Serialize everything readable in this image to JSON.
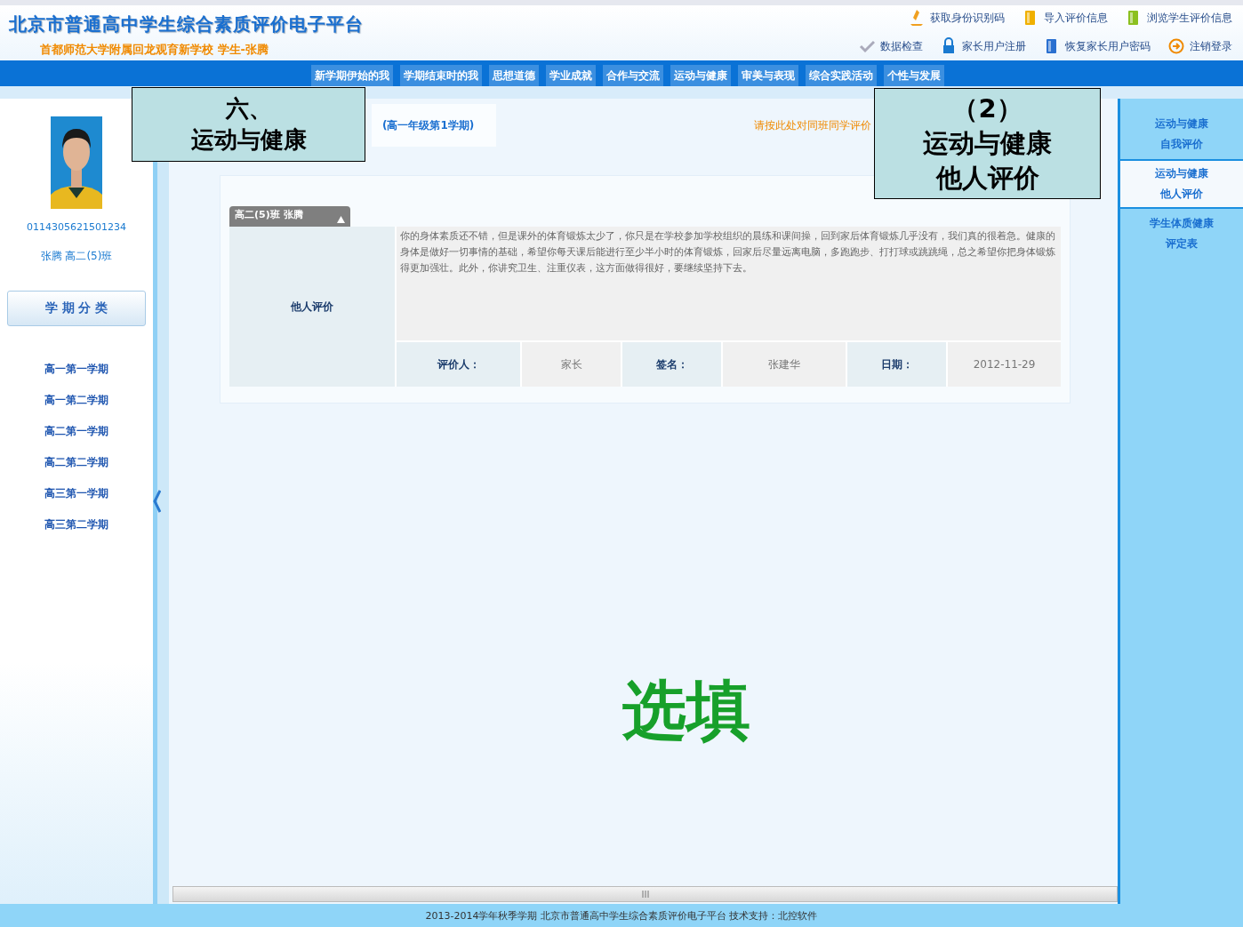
{
  "header": {
    "title": "北京市普通高中学生综合素质评价电子平台",
    "subtitle": "首都师范大学附属回龙观育新学校  学生-张腾",
    "links": [
      [
        {
          "label": "获取身份识别码"
        },
        {
          "label": "导入评价信息"
        },
        {
          "label": "浏览学生评价信息"
        }
      ],
      [
        {
          "label": "数据检查"
        },
        {
          "label": "家长用户注册"
        },
        {
          "label": "恢复家长用户密码"
        },
        {
          "label": "注销登录"
        }
      ]
    ]
  },
  "nav": [
    "新学期伊始的我",
    "学期结束时的我",
    "思想道德",
    "学业成就",
    "合作与交流",
    "运动与健康",
    "审美与表现",
    "综合实践活动",
    "个性与发展"
  ],
  "student": {
    "id": "0114305621501234",
    "name": "张腾 高二(5)班"
  },
  "semester_heading": "学 期 分 类",
  "semesters": [
    "高一第一学期",
    "高一第二学期",
    "高二第一学期",
    "高二第二学期",
    "高三第一学期",
    "高三第二学期"
  ],
  "main": {
    "tab": "(高一年级第1学期)",
    "peer_link": "请按此处对同班同学评价",
    "panel_title": "高二(5)班 张腾",
    "row_label": "他人评价",
    "comment": "你的身体素质还不错，但是课外的体育锻炼太少了，你只是在学校参加学校组织的晨练和课间操，回到家后体育锻炼几乎没有，我们真的很着急。健康的身体是做好一切事情的基础，希望你每天课后能进行至少半小时的体育锻炼，回家后尽量远离电脑，多跑跑步、打打球或跳跳绳，总之希望你把身体锻炼得更加强壮。此外，你讲究卫生、注重仪表，这方面做得很好，要继续坚持下去。",
    "fields": [
      {
        "label": "评价人：",
        "value": "家长"
      },
      {
        "label": "签名：",
        "value": "张建华"
      },
      {
        "label": "日期：",
        "value": "2012-11-29"
      }
    ]
  },
  "right_menu": [
    {
      "lines": [
        "运动与健康",
        "自我评价"
      ],
      "selected": false
    },
    {
      "lines": [
        "运动与健康",
        "他人评价"
      ],
      "selected": true
    },
    {
      "lines": [
        "学生体质健康",
        "评定表"
      ],
      "selected": false
    }
  ],
  "footer": "2013-2014学年秋季学期  北京市普通高中学生综合素质评价电子平台  技术支持：北控软件",
  "callouts": [
    {
      "lines": [
        "六、",
        "运动与健康"
      ]
    },
    {
      "lines": [
        "（2）",
        "运动与健康",
        "他人评价"
      ]
    }
  ],
  "stamp": "选填"
}
